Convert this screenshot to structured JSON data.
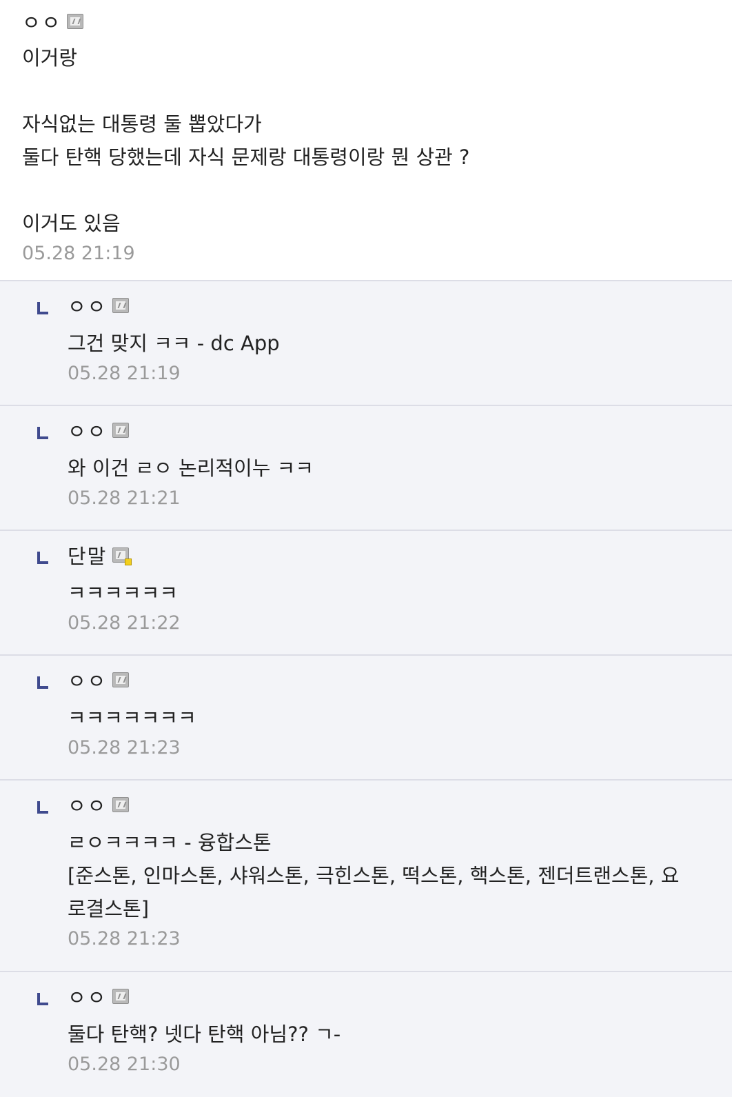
{
  "top_comment": {
    "author": "ㅇㅇ",
    "body": "이거랑\n\n자식없는 대통령 둘 뽑았다가\n둘다 탄핵 당했는데 자식 문제랑 대통령이랑 뭔 상관 ?\n\n이거도 있음",
    "timestamp": "05.28 21:19"
  },
  "replies": [
    {
      "author": "ㅇㅇ",
      "body": "그건 맞지 ㅋㅋ - dc App",
      "timestamp": "05.28 21:19"
    },
    {
      "author": "ㅇㅇ",
      "body": "와 이건 ㄹㅇ 논리적이누 ㅋㅋ",
      "timestamp": "05.28 21:21"
    },
    {
      "author": "단말",
      "body": "ㅋㅋㅋㅋㅋㅋ",
      "timestamp": "05.28 21:22"
    },
    {
      "author": "ㅇㅇ",
      "body": "ㅋㅋㅋㅋㅋㅋㅋ",
      "timestamp": "05.28 21:23"
    },
    {
      "author": "ㅇㅇ",
      "body": "ㄹㅇㅋㅋㅋㅋ - 융합스톤\n[준스톤, 인마스톤, 샤워스톤, 극힌스톤, 떡스톤, 핵스톤, 젠더트랜스톤, 요\n로결스톤]",
      "timestamp": "05.28 21:23"
    },
    {
      "author": "ㅇㅇ",
      "body": "둘다 탄핵? 넷다 탄핵 아님?? ㄱ-",
      "timestamp": "05.28 21:30"
    }
  ],
  "icons": {
    "reply_arrow": "reply-arrow-icon",
    "nick": "nickname-icon",
    "fixed_nick": "fixed-nickname-icon"
  },
  "colors": {
    "reply_bg": "#f3f4f8",
    "divider": "#dcdde6",
    "reply_arrow": "#3f4a8e",
    "timestamp": "#9a9a9a"
  }
}
